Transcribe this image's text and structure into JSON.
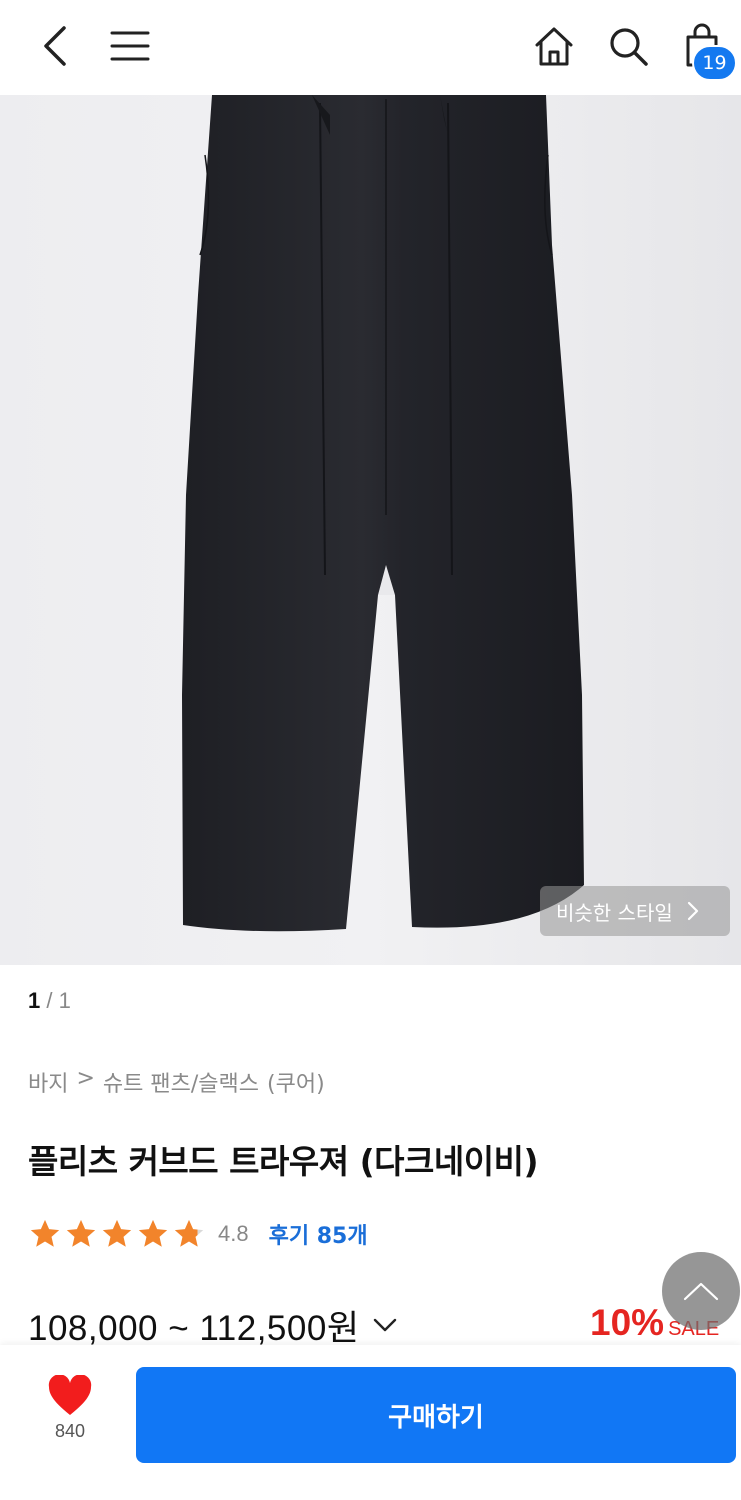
{
  "header": {
    "cart_count": "19",
    "icons": [
      "back-arrow-icon",
      "menu-icon",
      "home-icon",
      "search-icon",
      "shopping-bag-icon"
    ]
  },
  "image": {
    "similar_style_label": "비슷한 스타일",
    "page_current": "1",
    "page_separator": "/",
    "page_total": "1"
  },
  "breadcrumb": {
    "items": [
      "바지",
      ">",
      "슈트 팬츠/슬랙스",
      "(쿠어)"
    ]
  },
  "product": {
    "title": "플리츠 커브드 트라우져 (다크네이비)",
    "rating": "4.8",
    "rating_stars": 4.8,
    "review_label": "후기 85개",
    "price": "108,000 ~ 112,500원",
    "discount_pct": "10%",
    "discount_label": "SALE"
  },
  "bottom": {
    "like_count": "840",
    "buy_label": "구매하기"
  },
  "colors": {
    "accent_blue": "#1177f5",
    "sale_red": "#e52521",
    "star_orange": "#f2842b",
    "heart_red": "#f21d1d"
  }
}
